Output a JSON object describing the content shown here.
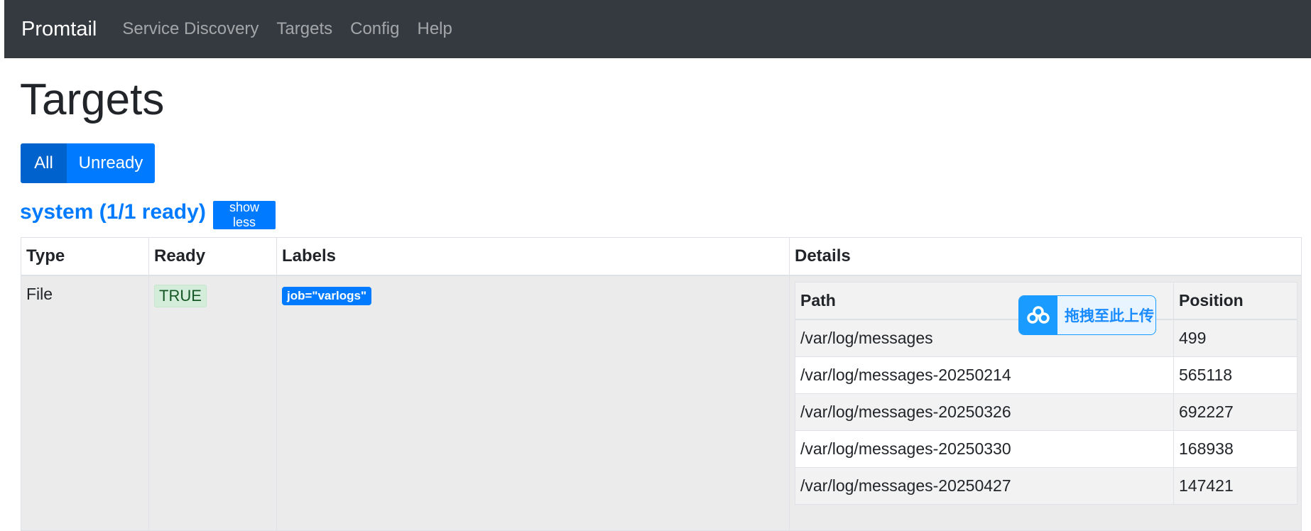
{
  "navbar": {
    "brand": "Promtail",
    "links": [
      "Service Discovery",
      "Targets",
      "Config",
      "Help"
    ]
  },
  "page": {
    "title": "Targets"
  },
  "filters": {
    "all_label": "All",
    "unready_label": "Unready"
  },
  "section": {
    "title": "system (1/1 ready)",
    "toggle_label": "show less"
  },
  "table": {
    "headers": [
      "Type",
      "Ready",
      "Labels",
      "Details"
    ],
    "row": {
      "type": "File",
      "ready": "TRUE",
      "label": "job=\"varlogs\""
    }
  },
  "details": {
    "headers": [
      "Path",
      "Position"
    ],
    "rows": [
      {
        "path": "/var/log/messages",
        "position": "499"
      },
      {
        "path": "/var/log/messages-20250214",
        "position": "565118"
      },
      {
        "path": "/var/log/messages-20250326",
        "position": "692227"
      },
      {
        "path": "/var/log/messages-20250330",
        "position": "168938"
      },
      {
        "path": "/var/log/messages-20250427",
        "position": "147421"
      }
    ]
  },
  "upload_overlay": {
    "text": "拖拽至此上传",
    "icon": "cloud-upload-icon"
  },
  "colors": {
    "navbar": "#343a40",
    "primary": "#007bff",
    "primary_active": "#0062cc",
    "success_bg": "#d4edda",
    "upload_accent": "#1a9bff"
  }
}
